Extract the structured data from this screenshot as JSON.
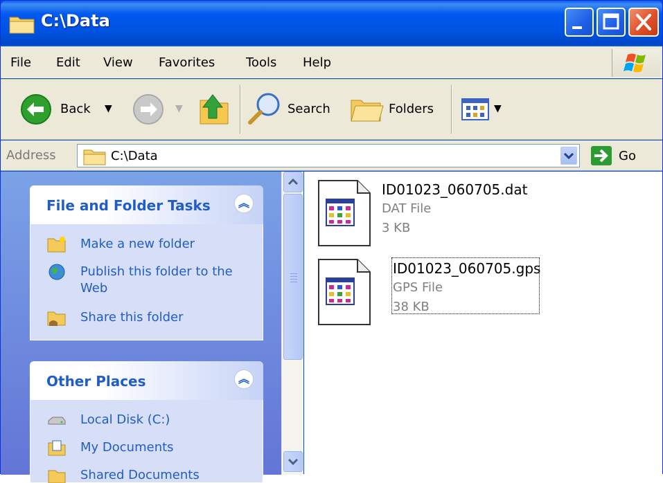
{
  "window": {
    "title": "C:\\Data"
  },
  "menu": {
    "items": [
      "File",
      "Edit",
      "View",
      "Favorites",
      "Tools",
      "Help"
    ]
  },
  "toolbar": {
    "back_label": "Back",
    "search_label": "Search",
    "folders_label": "Folders"
  },
  "address": {
    "label": "Address",
    "value": "C:\\Data",
    "go_label": "Go"
  },
  "taskpane": {
    "file_tasks": {
      "title": "File and Folder Tasks",
      "items": [
        {
          "label": "Make a new folder",
          "icon": "new-folder-icon"
        },
        {
          "label": "Publish this folder to the Web",
          "icon": "globe-icon"
        },
        {
          "label": "Share this folder",
          "icon": "share-folder-icon"
        }
      ]
    },
    "other_places": {
      "title": "Other Places",
      "items": [
        {
          "label": "Local Disk (C:)",
          "icon": "disk-drive-icon"
        },
        {
          "label": "My Documents",
          "icon": "my-documents-icon"
        },
        {
          "label": "Shared Documents",
          "icon": "shared-documents-icon"
        }
      ]
    }
  },
  "files": [
    {
      "name": "ID01023_060705.dat",
      "type": "DAT File",
      "size": "3 KB",
      "selected": false
    },
    {
      "name": "ID01023_060705.gps",
      "type": "GPS File",
      "size": "38 KB",
      "selected": true
    }
  ],
  "colors": {
    "titlebar": "#0054e3",
    "chrome": "#ece9d8",
    "task_link": "#215dc6",
    "taskpane_bg": "#7ba2e7"
  }
}
